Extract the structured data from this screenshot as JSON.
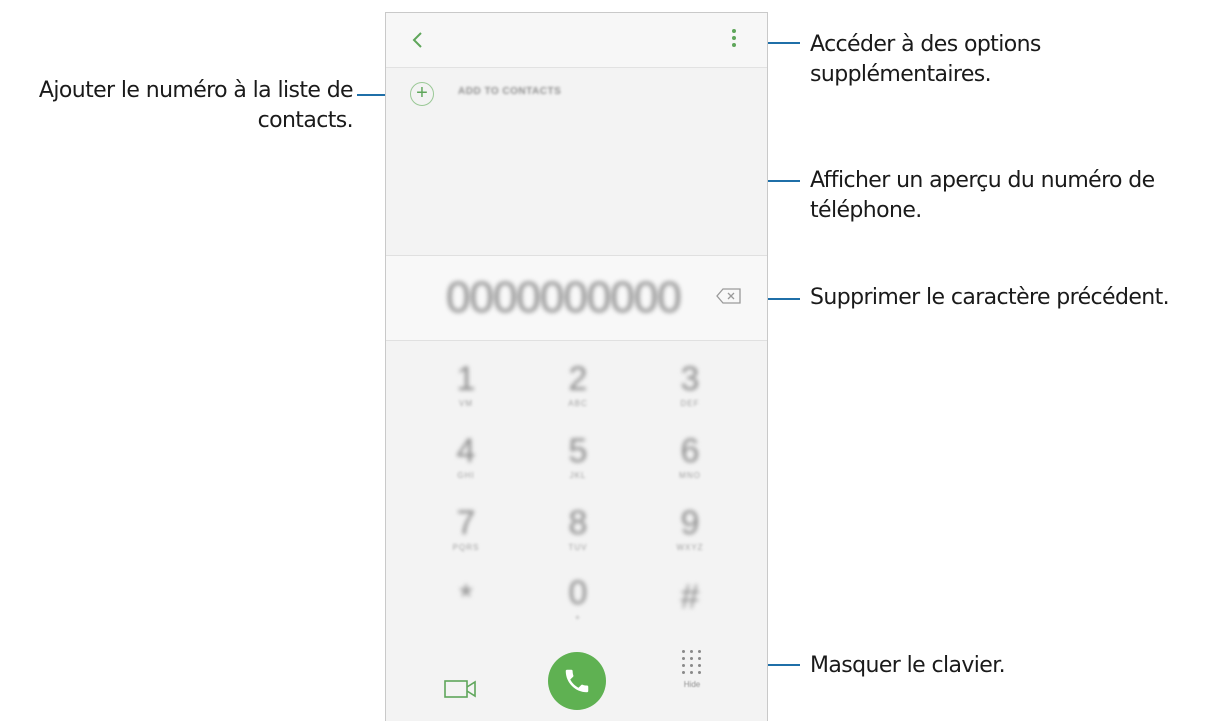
{
  "callouts": {
    "add_contact_line1": "Ajouter le numéro à la liste de",
    "add_contact_line2": "contacts.",
    "more_options_line1": "Accéder à des options",
    "more_options_line2": "supplémentaires.",
    "preview_line1": "Afficher un aperçu du numéro de",
    "preview_line2": "téléphone.",
    "delete_char": "Supprimer le caractère précédent.",
    "hide_keypad": "Masquer le clavier."
  },
  "phone": {
    "add_to_contacts_label": "ADD TO CONTACTS",
    "number": "0000000000",
    "hide_label": "Hide",
    "keys": [
      {
        "digit": "1",
        "letters": "VM"
      },
      {
        "digit": "2",
        "letters": "ABC"
      },
      {
        "digit": "3",
        "letters": "DEF"
      },
      {
        "digit": "4",
        "letters": "GHI"
      },
      {
        "digit": "5",
        "letters": "JKL"
      },
      {
        "digit": "6",
        "letters": "MNO"
      },
      {
        "digit": "7",
        "letters": "PQRS"
      },
      {
        "digit": "8",
        "letters": "TUV"
      },
      {
        "digit": "9",
        "letters": "WXYZ"
      },
      {
        "digit": "*",
        "letters": ""
      },
      {
        "digit": "0",
        "letters": "+"
      },
      {
        "digit": "#",
        "letters": ""
      }
    ],
    "accent_color": "#5fb152",
    "icons": [
      "back-icon",
      "more-options-icon",
      "add-contact-icon",
      "backspace-icon",
      "video-call-icon",
      "phone-icon",
      "keypad-hide-icon"
    ]
  }
}
